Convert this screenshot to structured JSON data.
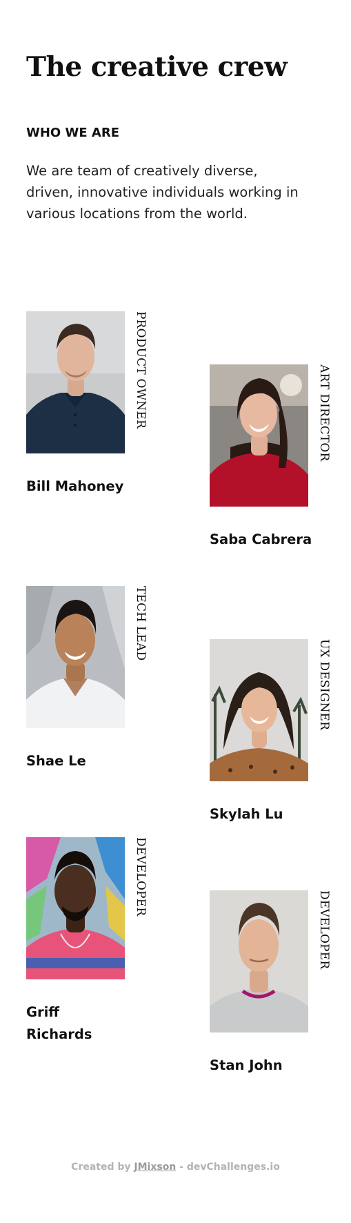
{
  "header": {
    "title": "The creative crew",
    "section_label": "WHO WE ARE",
    "intro": "We are team of creatively diverse, driven, innovative individuals working in various locations from the world."
  },
  "team": [
    {
      "name": "Bill Mahoney",
      "role": "PRODUCT OWNER"
    },
    {
      "name": "Saba Cabrera",
      "role": "ART DIRECTOR"
    },
    {
      "name": "Shae Le",
      "role": "TECH LEAD"
    },
    {
      "name": "Skylah Lu",
      "role": "UX DESIGNER"
    },
    {
      "name": "Griff Richards",
      "role": "DEVELOPER"
    },
    {
      "name": "Stan John",
      "role": "DEVELOPER"
    }
  ],
  "footer": {
    "prefix": "Created by ",
    "author_link": "JMixson",
    "separator": " - ",
    "site": "devChallenges.io"
  }
}
